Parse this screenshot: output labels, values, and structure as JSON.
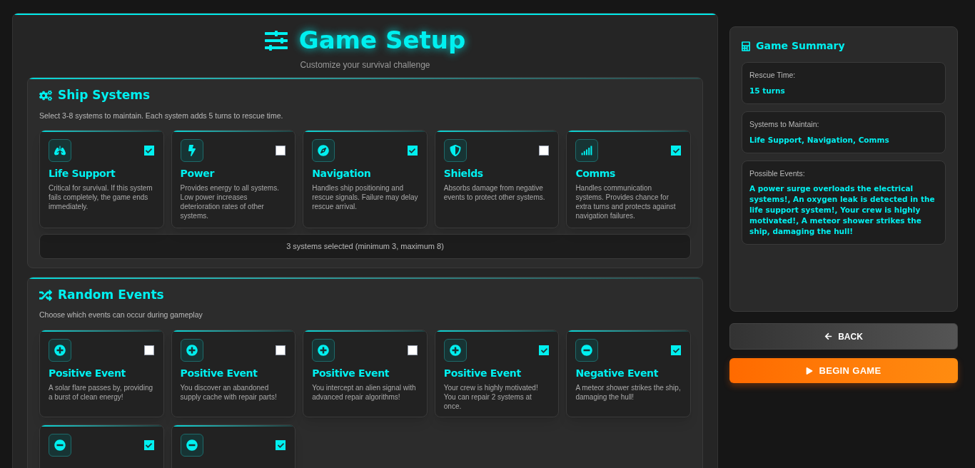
{
  "header": {
    "title": "Game Setup",
    "subtitle": "Customize your survival challenge"
  },
  "systems_section": {
    "title": "Ship Systems",
    "description": "Select 3-8 systems to maintain. Each system adds 5 turns to rescue time.",
    "count_text": "3 systems selected (minimum 3, maximum 8)",
    "systems": [
      {
        "kind": "life",
        "name": "Life Support",
        "description": "Critical for survival. If this system fails completely, the game ends immediately.",
        "checked": true
      },
      {
        "kind": "power",
        "name": "Power",
        "description": "Provides energy to all systems. Low power increases deterioration rates of other systems.",
        "checked": false
      },
      {
        "kind": "navigation",
        "name": "Navigation",
        "description": "Handles ship positioning and rescue signals. Failure may delay rescue arrival.",
        "checked": true
      },
      {
        "kind": "shields",
        "name": "Shields",
        "description": "Absorbs damage from negative events to protect other systems.",
        "checked": false
      },
      {
        "kind": "comms",
        "name": "Comms",
        "description": "Handles communication systems. Provides chance for extra turns and protects against navigation failures.",
        "checked": true
      }
    ]
  },
  "events_section": {
    "title": "Random Events",
    "description": "Choose which events can occur during gameplay",
    "events": [
      {
        "kind": "positive",
        "name": "Positive Event",
        "description": "A solar flare passes by, providing a burst of clean energy!",
        "checked": false
      },
      {
        "kind": "positive",
        "name": "Positive Event",
        "description": "You discover an abandoned supply cache with repair parts!",
        "checked": false
      },
      {
        "kind": "positive",
        "name": "Positive Event",
        "description": "You intercept an alien signal with advanced repair algorithms!",
        "checked": false
      },
      {
        "kind": "positive",
        "name": "Positive Event",
        "description": "Your crew is highly motivated! You can repair 2 systems at once.",
        "checked": true
      },
      {
        "kind": "negative",
        "name": "Negative Event",
        "description": "A meteor shower strikes the ship, damaging the hull!",
        "checked": true
      },
      {
        "kind": "negative",
        "checked": true
      },
      {
        "kind": "negative",
        "checked": true
      }
    ]
  },
  "summary": {
    "title": "Game Summary",
    "items": [
      {
        "label": "Rescue Time:",
        "value": "15 turns"
      },
      {
        "label": "Systems to Maintain:",
        "value": "Life Support, Navigation, Comms"
      },
      {
        "label": "Possible Events:",
        "value": "A power surge overloads the electrical systems!, An oxygen leak is detected in the life support system!, Your crew is highly motivated!, A meteor shower strikes the ship, damaging the hull!"
      }
    ]
  },
  "buttons": {
    "back": "BACK",
    "begin": "BEGIN GAME"
  }
}
